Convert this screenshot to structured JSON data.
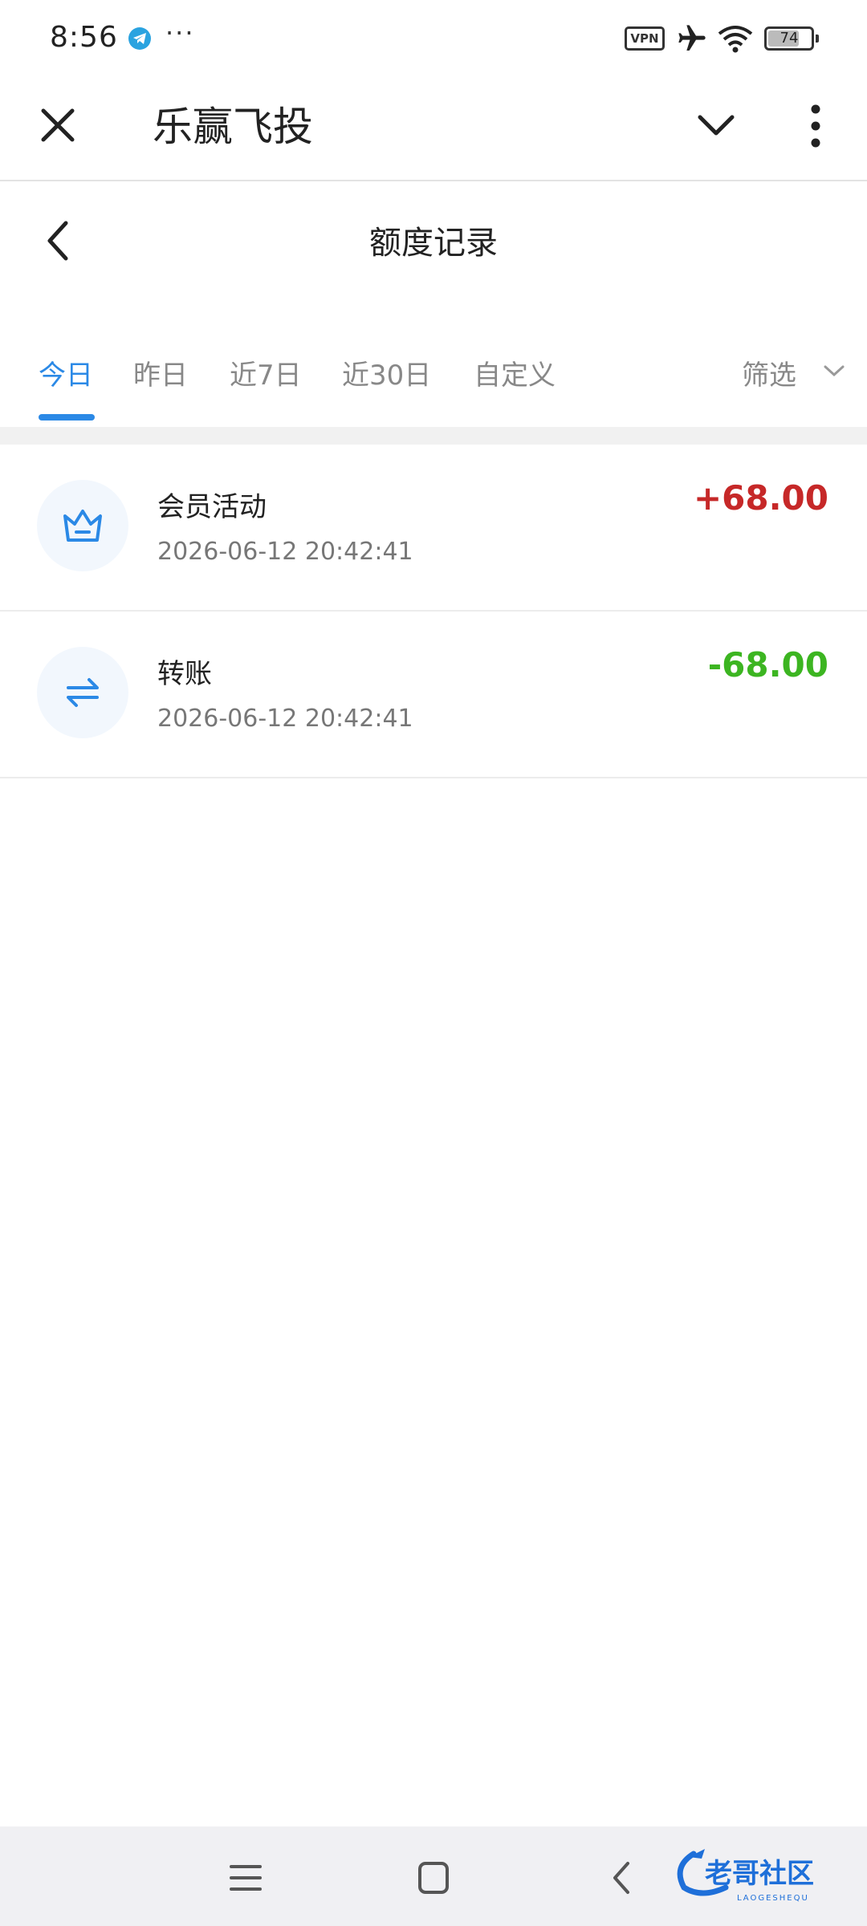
{
  "status_bar": {
    "time": "8:56",
    "more": "···",
    "vpn": "VPN",
    "battery_level": "74",
    "battery_fraction": 0.74
  },
  "header": {
    "app_title": "乐赢飞投"
  },
  "page": {
    "title": "额度记录"
  },
  "tabs": [
    {
      "label": "今日",
      "active": true
    },
    {
      "label": "昨日",
      "active": false
    },
    {
      "label": "近7日",
      "active": false
    },
    {
      "label": "近30日",
      "active": false
    },
    {
      "label": "自定义",
      "active": false
    }
  ],
  "filter": {
    "label": "筛选"
  },
  "records": [
    {
      "title": "会员活动",
      "time": "2026-06-12 20:42:41",
      "amount": "+68.00",
      "amount_color": "#c62828",
      "icon": "crown-icon"
    },
    {
      "title": "转账",
      "time": "2026-06-12 20:42:41",
      "amount": "-68.00",
      "amount_color": "#3cb521",
      "icon": "transfer-icon"
    }
  ],
  "watermark": {
    "text": "老哥社区",
    "subtext": "LAOGESHEQU"
  },
  "colors": {
    "accent": "#2b89e6",
    "positive": "#c62828",
    "negative": "#3cb521"
  }
}
